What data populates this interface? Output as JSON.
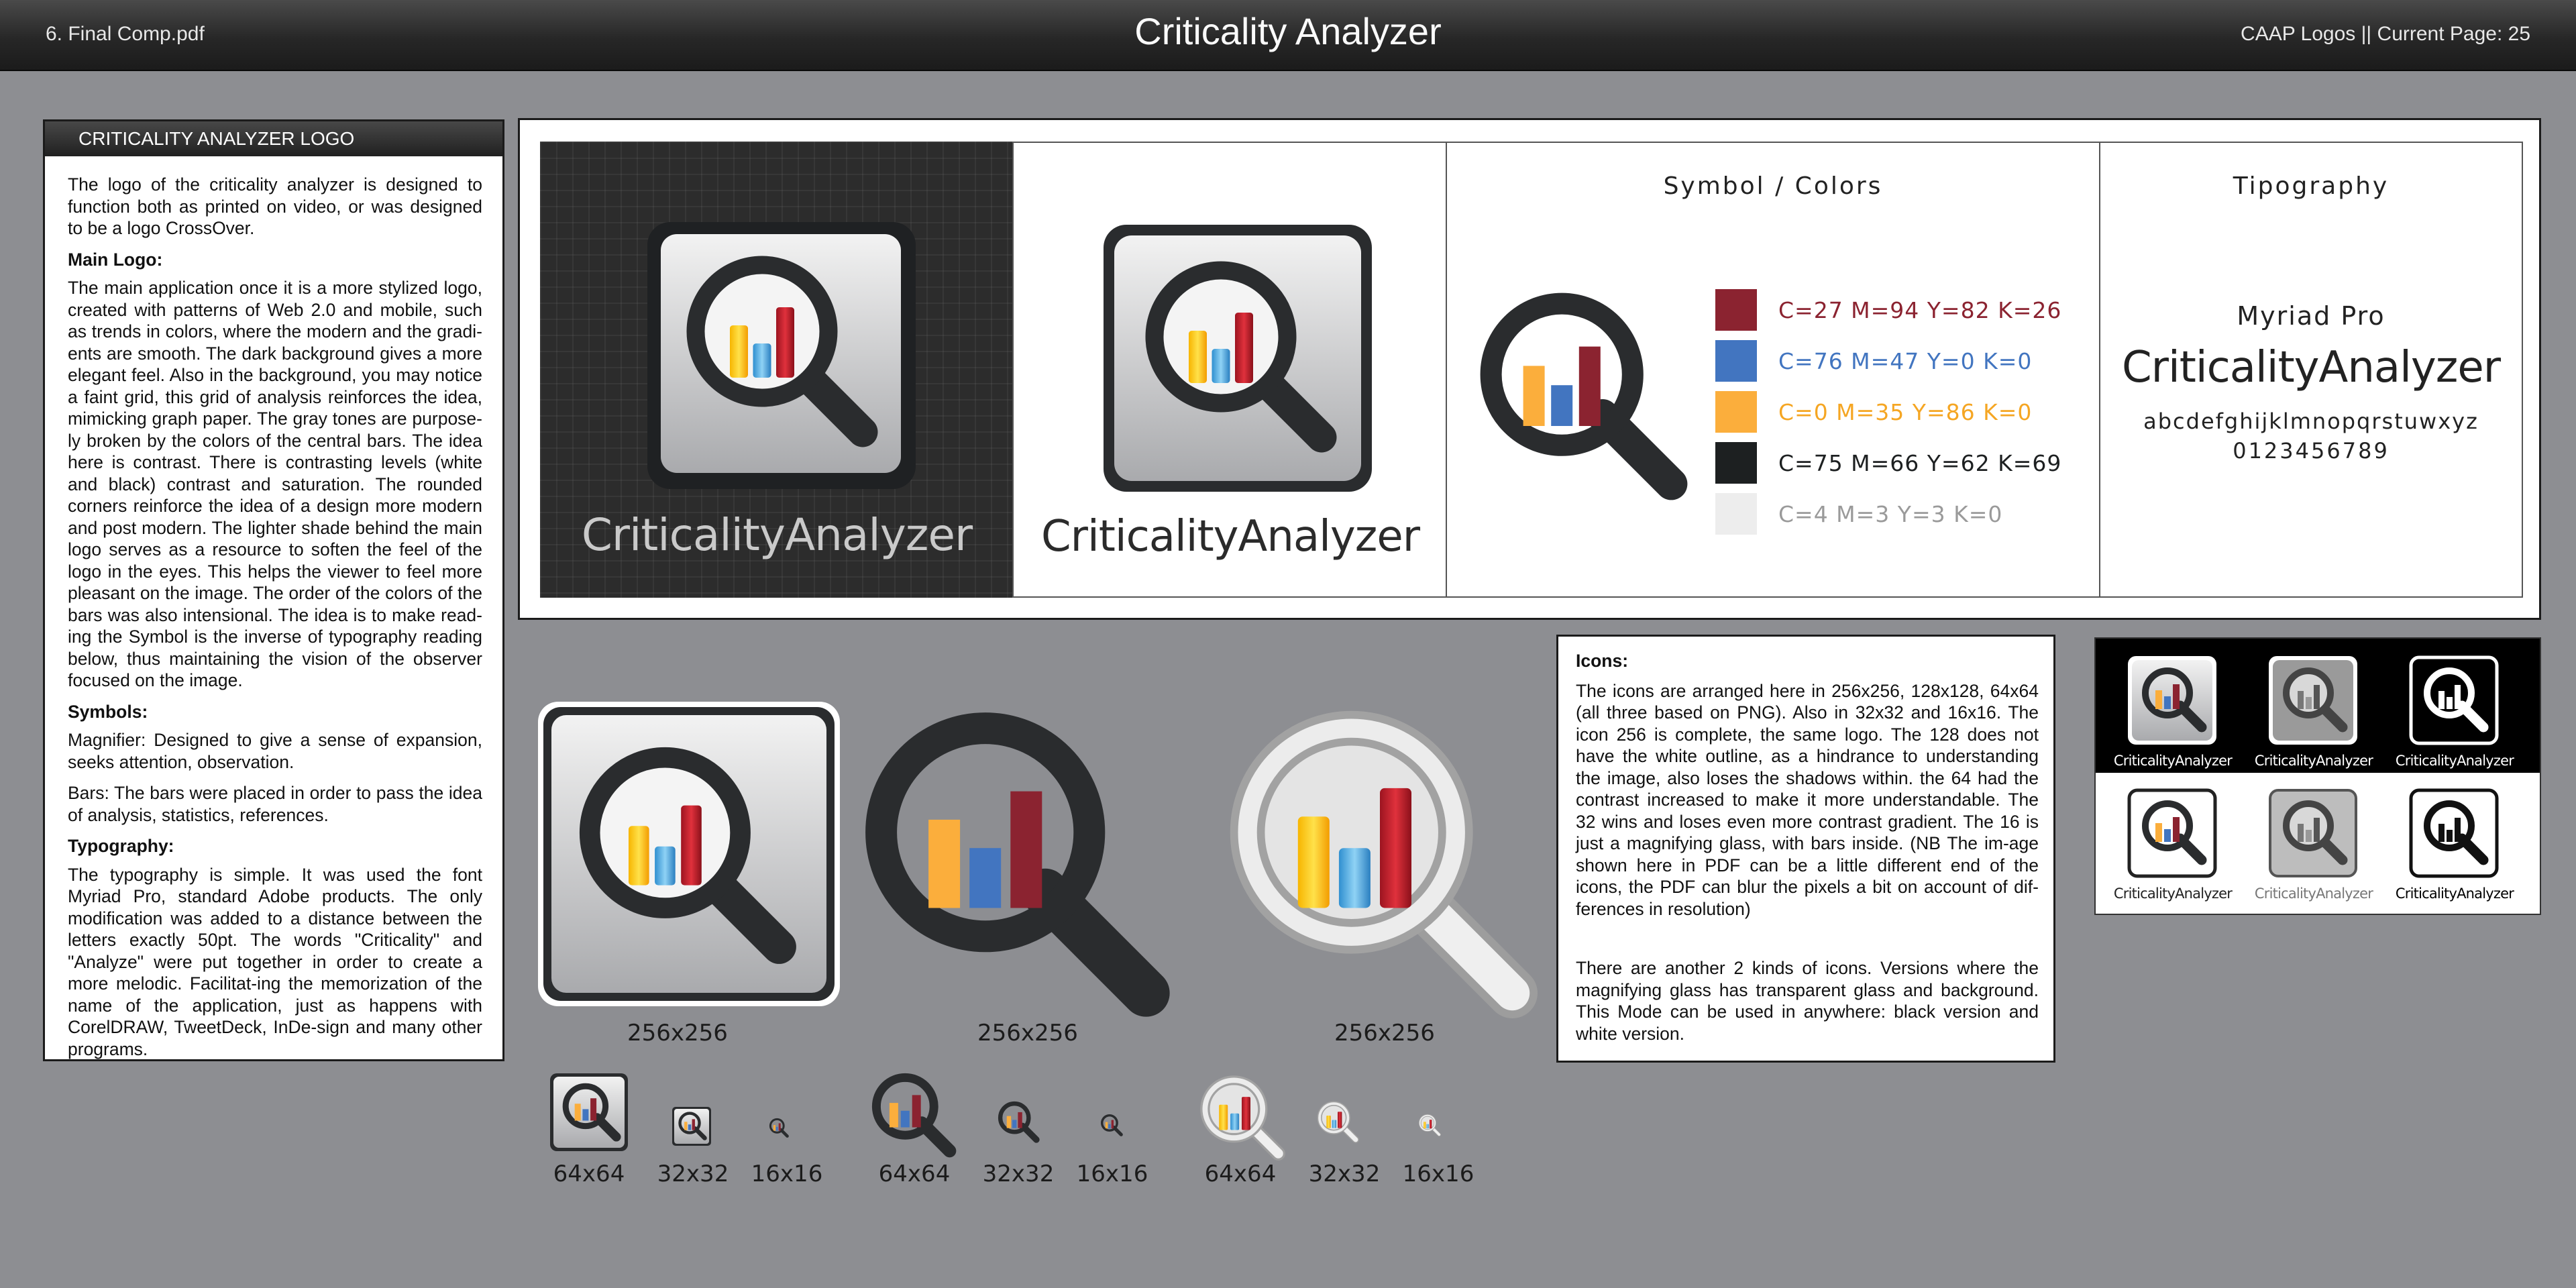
{
  "header": {
    "document_name": "6. Final Comp.pdf",
    "app_title": "Criticality Analyzer",
    "page_info": "CAAP Logos || Current Page: 25"
  },
  "description": {
    "header": "CRITICALITY ANALYZER LOGO",
    "intro": "The logo of the criticality analyzer is designed to function both as printed on video, or was designed to be a logo CrossOver.",
    "main_logo_heading": "Main Logo:",
    "main_logo_text": "The main application once it is a more stylized logo, created with patterns of Web 2.0 and mobile, such as trends in colors, where the modern and the gradi-ents are smooth. The dark background gives a more elegant feel. Also in the background, you may notice a faint grid, this grid of analysis reinforces the idea, mimicking graph paper. The gray tones are purpose-ly broken by the colors of the central bars. The idea here is contrast. There is contrasting levels (white and black) contrast and saturation. The rounded corners reinforce the idea of a design more modern and post modern. The lighter shade behind the main logo serves as a resource to soften the feel of the logo in the eyes. This helps the viewer to feel more pleasant on the image. The order of the colors of the bars was also intensional. The idea is to make read-ing the Symbol is the inverse of typography reading below, thus maintaining the vision of the observer focused on the image.",
    "symbols_heading": "Symbols:",
    "magnifier_text": "Magnifier: Designed to give a sense of expansion, seeks attention, observation.",
    "bars_text": "Bars: The bars were placed in order to pass the idea of analysis, statistics, references.",
    "typography_heading": "Typography:",
    "typography_text": "The typography is simple. It was used the font Myriad Pro, standard Adobe products. The only modification was added to a distance between the letters exactly 50pt. The words \"Criticality\" and \"Analyze\" were put together in order to create a more melodic. Facilitat-ing the memorization of the name of the application, just as happens with CorelDRAW, TweetDeck, InDe-sign and many other programs."
  },
  "showcase": {
    "dark_logo_word": "CriticalityAnalyzer",
    "light_logo_word": "CriticalityAnalyzer",
    "colors_title": "Symbol / Colors",
    "swatches": [
      {
        "label": "C=27 M=94 Y=82 K=26",
        "color": "#8b2330"
      },
      {
        "label": "C=76 M=47 Y=0 K=0",
        "color": "#4275c0"
      },
      {
        "label": "C=0 M=35 Y=86 K=0",
        "color": "#fbae3c"
      },
      {
        "label": "C=75 M=66 Y=62 K=69",
        "color": "#1d2021"
      },
      {
        "label": "C=4 M=3 Y=3 K=0",
        "color": "#ededed"
      }
    ],
    "label_colors": [
      "#8b2330",
      "#4275c0",
      "#f5a623",
      "#1d2021",
      "#9a9a9a"
    ],
    "typography_title": "Tipography",
    "font_name": "Myriad Pro",
    "typo_word": "CriticalityAnalyzer",
    "typo_letters": "abcdefghijklmnopqrstuwxyz",
    "typo_digits": "0123456789"
  },
  "icons_info": {
    "heading": "Icons:",
    "text1": "The icons are arranged here in 256x256, 128x128, 64x64 (all three based on PNG). Also in 32x32 and 16x16. The icon 256 is complete, the same logo. The 128 does not have the white outline, as a hindrance to understanding the image, also loses the shadows within. the 64 had the contrast increased to make it more understandable. The 32 wins and loses even more contrast gradient. The 16 is just a magnifying glass, with bars inside. (NB The im-age shown here in PDF can be a little different end of the icons, the PDF can blur the pixels a bit on account of dif-ferences in resolution)",
    "text2": "There are another 2 kinds of icons. Versions where the magnifying glass has transparent glass and background. This Mode can be used in anywhere: black version and white version."
  },
  "variations": {
    "captions": [
      "CriticalityAnalyzer",
      "CriticalityAnalyzer",
      "CriticalityAnalyzer",
      "CriticalityAnalyzer",
      "CriticalityAnalyzer",
      "CriticalityAnalyzer"
    ]
  },
  "icon_sizes": {
    "big": [
      "256x256",
      "256x256",
      "256x256"
    ],
    "small": [
      "64x64",
      "32x32",
      "16x16",
      "64x64",
      "32x32",
      "16x16",
      "64x64",
      "32x32",
      "16x16"
    ]
  }
}
